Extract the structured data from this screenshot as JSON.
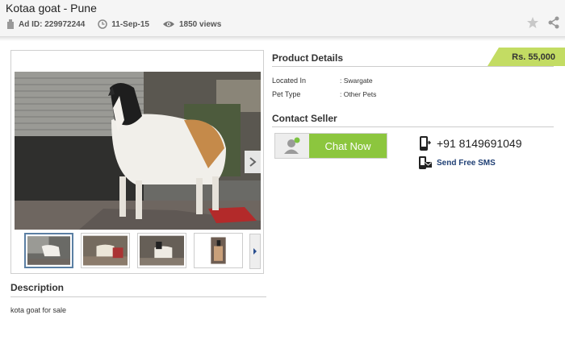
{
  "header": {
    "title": "Kotaa goat - Pune",
    "ad_id": "Ad ID: 229972244",
    "date": "11-Sep-15",
    "views": "1850 views"
  },
  "product_details": {
    "heading": "Product Details",
    "price": "Rs. 55,000",
    "rows": [
      {
        "key": "Located In",
        "value": ": Swargate"
      },
      {
        "key": "Pet Type",
        "value": ": Other Pets"
      }
    ]
  },
  "contact": {
    "heading": "Contact Seller",
    "chat_label": "Chat Now",
    "phone": "+91 8149691049",
    "sms_label": "Send Free SMS"
  },
  "description": {
    "heading": "Description",
    "text": "kota goat for sale"
  },
  "icons": [
    "tag-icon",
    "clock-icon",
    "eye-icon",
    "star-icon",
    "share-icon",
    "chevron-right-icon",
    "avatar-icon",
    "phone-icon",
    "sms-icon"
  ],
  "colors": {
    "price_badge": "#c3dc63",
    "chat_button": "#8cc63e",
    "sms_link": "#1f3f74"
  }
}
